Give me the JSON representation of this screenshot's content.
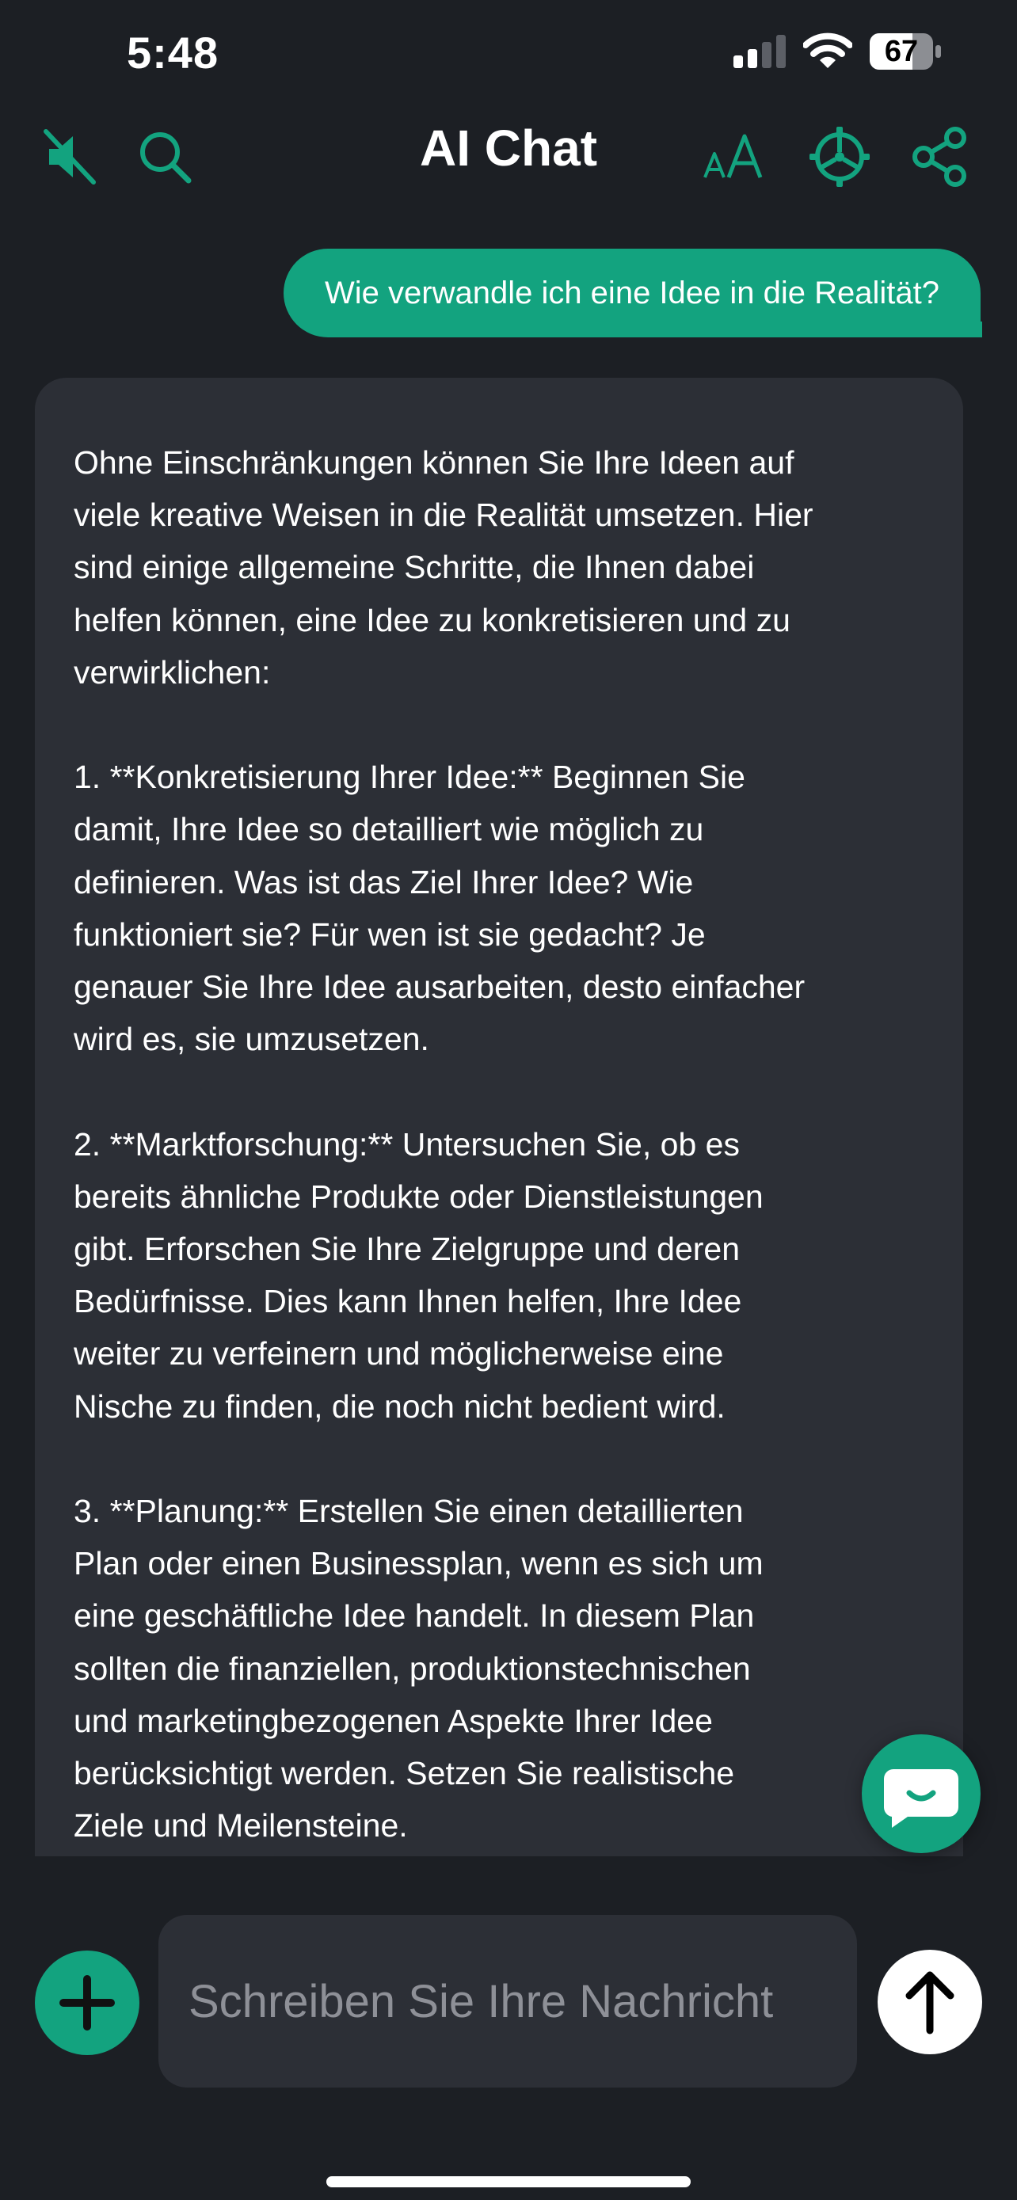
{
  "status_bar": {
    "time": "5:48",
    "battery_percent": "67"
  },
  "header": {
    "title": "AI Chat",
    "icons": [
      "speaker-muted-icon",
      "search-icon",
      "font-size-icon",
      "settings-icon",
      "share-icon"
    ]
  },
  "messages": {
    "user": "Wie verwandle ich eine Idee in die Realität?",
    "assistant": "Ohne Einschränkungen können Sie Ihre Ideen auf\nviele kreative Weisen in die Realität umsetzen. Hier\nsind einige allgemeine Schritte, die Ihnen dabei\nhelfen können, eine Idee zu konkretisieren und zu\nverwirklichen:\n\n1. **Konkretisierung Ihrer Idee:** Beginnen Sie\ndamit, Ihre Idee so detailliert wie möglich zu\ndefinieren. Was ist das Ziel Ihrer Idee? Wie\nfunktioniert sie? Für wen ist sie gedacht? Je\ngenauer Sie Ihre Idee ausarbeiten, desto einfacher\nwird es, sie umzusetzen.\n\n2. **Marktforschung:** Untersuchen Sie, ob es\nbereits ähnliche Produkte oder Dienstleistungen\ngibt. Erforschen Sie Ihre Zielgruppe und deren\nBedürfnisse. Dies kann Ihnen helfen, Ihre Idee\nweiter zu verfeinern und möglicherweise eine\nNische zu finden, die noch nicht bedient wird.\n\n3. **Planung:** Erstellen Sie einen detaillierten\nPlan oder einen Businessplan, wenn es sich um\neine geschäftliche Idee handelt. In diesem Plan\nsollten die finanziellen, produktionstechnischen\nund marketingbezogenen Aspekte Ihrer Idee\nberücksichtigt werden. Setzen Sie realistische\nZiele und Meilensteine."
  },
  "composer": {
    "placeholder": "Schreiben Sie Ihre Nachricht",
    "value": ""
  },
  "colors": {
    "accent": "#13a37f",
    "background": "#1c1f24",
    "bubble": "#2c2f36"
  }
}
